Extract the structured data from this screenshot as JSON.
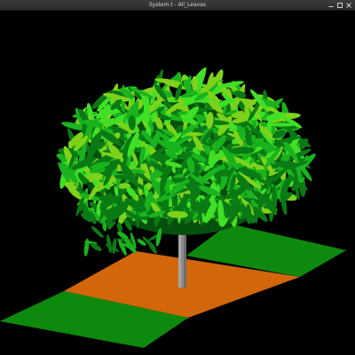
{
  "window": {
    "title": "System.t - All_Leaves"
  },
  "window_controls": {
    "icons": [
      "minimize-icon",
      "maximize-icon",
      "close-icon"
    ]
  },
  "scene": {
    "description_icons": [
      "ground-plane",
      "tree-trunk",
      "tree-canopy"
    ],
    "colors": {
      "background": "#000000",
      "ground_green": "#0d8a0d",
      "ground_orange": "#d2660a",
      "trunk": "#8c8c8c",
      "leaf_dark": "#0a7a14",
      "leaf_mid": "#19b31e",
      "leaf_light": "#3fe026",
      "leaf_yellow": "#7fd21a"
    }
  }
}
